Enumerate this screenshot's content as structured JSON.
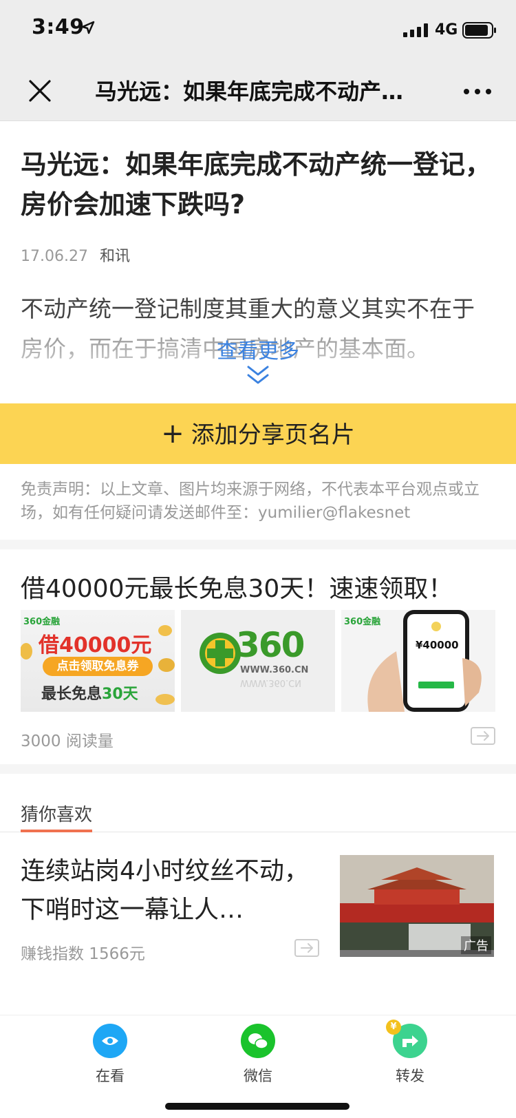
{
  "status": {
    "time": "3:49",
    "network": "4G"
  },
  "nav": {
    "title": "马光远：如果年底完成不动产…"
  },
  "article": {
    "title": "马光远：如果年底完成不动产统一登记，房价会加速下跌吗?",
    "date": "17.06.27",
    "source": "和讯",
    "excerpt": "不动产统一登记制度其重大的意义其实不在于房价，而在于搞清中国房地产的基本面。",
    "read_more": "查看更多"
  },
  "add_card_button": {
    "plus": "+",
    "label": "添加分享页名片"
  },
  "disclaimer": "免责声明：以上文章、图片均来源于网络，不代表本平台观点或立场，如有任何疑问请发送邮件至：yumilier@flakesnet",
  "ad": {
    "title": "借40000元最长免息30天！速速领取！",
    "image1": {
      "brand": "360金融",
      "line1": "借40000元",
      "pill": "点击领取免息券",
      "line2_prefix": "最长免息",
      "line2_num": "30天"
    },
    "image2": {
      "logo": "360",
      "url": "WWW.360.CN"
    },
    "image3": {
      "brand": "360金融",
      "amount": "¥40000"
    },
    "reads": "3000 阅读量"
  },
  "recommend": {
    "header": "猜你喜欢",
    "item": {
      "title": "连续站岗4小时纹丝不动，下哨时这一幕让人…",
      "stat": "赚钱指数 1566元",
      "badge": "广告"
    }
  },
  "bottom_tabs": [
    {
      "label": "在看",
      "icon": "eye-icon",
      "color": "#1ea7f5"
    },
    {
      "label": "微信",
      "icon": "wechat-icon",
      "color": "#1ac32c"
    },
    {
      "label": "转发",
      "icon": "forward-icon",
      "color": "#3cd38f"
    }
  ],
  "colors": {
    "accent_yellow": "#fcd453",
    "link_blue": "#3b82e0",
    "tab_underline": "#f07150"
  }
}
